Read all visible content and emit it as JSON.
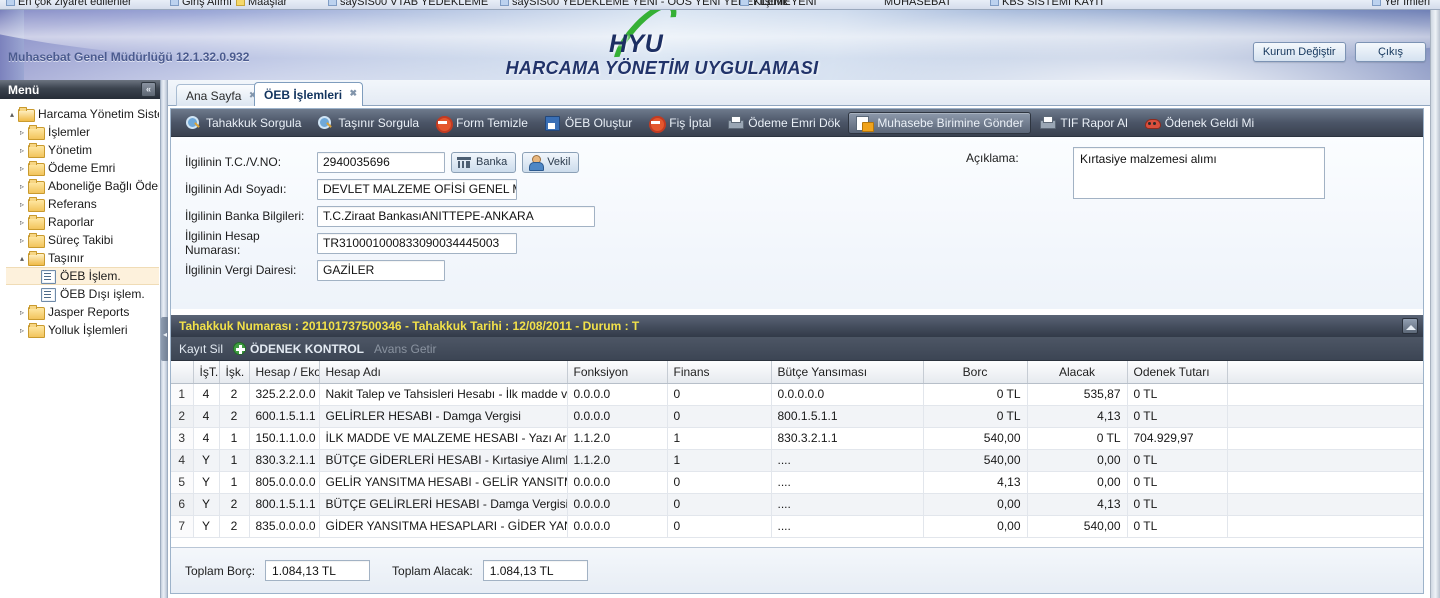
{
  "browser": {
    "bookmarks": [
      {
        "label": "En çok ziyaret edilenler",
        "icon": "bookmark-icon"
      },
      {
        "label": "Giriş Alımı",
        "icon": "bookmark-icon"
      },
      {
        "label": "Maaşlar",
        "icon": "folder-icon"
      },
      {
        "label": "saySIS00 VTAB YEDEKLEME",
        "icon": "bookmark-icon"
      },
      {
        "label": "saySIS00 YEDEKLEME YENI - OOS YENI YEDEKLEME",
        "icon": "bookmark-icon"
      },
      {
        "label": "Yılşırlık YENI",
        "icon": "bookmark-icon"
      },
      {
        "label": "MUHASEBAT",
        "icon": "star-icon"
      },
      {
        "label": "KBS SİSTEMİ KAYIT",
        "icon": "bookmark-icon"
      },
      {
        "label": "Yer İmleri",
        "icon": "bookmark-icon"
      }
    ]
  },
  "banner": {
    "version": "Muhasebat Genel Müdürlüğü 12.1.32.0.932",
    "logo_text": "HYU",
    "subtitle": "HARCAMA YÖNETİM UYGULAMASI",
    "buttons": [
      {
        "label": "Kurum Değiştir",
        "name": "kurum-degistir-button"
      },
      {
        "label": "Çıkış",
        "name": "cikis-button"
      }
    ]
  },
  "menu": {
    "title": "Menü",
    "collapse_icon": "double-chevron-left-icon",
    "tree": [
      {
        "label": "Harcama Yönetim Sistemi",
        "level": 0,
        "type": "folder-open",
        "arrow": "▴",
        "selected": false
      },
      {
        "label": "İşlemler",
        "level": 1,
        "type": "folder",
        "arrow": "▹",
        "selected": false
      },
      {
        "label": "Yönetim",
        "level": 1,
        "type": "folder",
        "arrow": "▹",
        "selected": false
      },
      {
        "label": "Ödeme Emri",
        "level": 1,
        "type": "folder",
        "arrow": "▹",
        "selected": false
      },
      {
        "label": "Aboneliğe Bağlı Ödeme",
        "level": 1,
        "type": "folder",
        "arrow": "▹",
        "selected": false
      },
      {
        "label": "Referans",
        "level": 1,
        "type": "folder",
        "arrow": "▹",
        "selected": false
      },
      {
        "label": "Raporlar",
        "level": 1,
        "type": "folder",
        "arrow": "▹",
        "selected": false
      },
      {
        "label": "Süreç Takibi",
        "level": 1,
        "type": "folder",
        "arrow": "▹",
        "selected": false
      },
      {
        "label": "Taşınır",
        "level": 1,
        "type": "folder-open",
        "arrow": "▴",
        "selected": false
      },
      {
        "label": "ÖEB İşlem.",
        "level": 2,
        "type": "leaf",
        "arrow": "",
        "selected": true
      },
      {
        "label": "ÖEB Dışı işlem.",
        "level": 2,
        "type": "leaf",
        "arrow": "",
        "selected": false
      },
      {
        "label": "Jasper Reports",
        "level": 1,
        "type": "folder",
        "arrow": "▹",
        "selected": false
      },
      {
        "label": "Yolluk İşlemleri",
        "level": 1,
        "type": "folder",
        "arrow": "▹",
        "selected": false
      }
    ]
  },
  "tabs": [
    {
      "label": "Ana Sayfa",
      "active": false,
      "close_icon": "close-icon"
    },
    {
      "label": "ÖEB İşlemleri",
      "active": true,
      "close_icon": "close-icon"
    }
  ],
  "toolbar": [
    {
      "label": "Tahakkuk Sorgula",
      "icon": "search-icon",
      "active": false
    },
    {
      "label": "Taşınır Sorgula",
      "icon": "search-icon",
      "active": false
    },
    {
      "label": "Form Temizle",
      "icon": "cancel-icon",
      "active": false
    },
    {
      "label": "ÖEB Oluştur",
      "icon": "save-icon",
      "active": false
    },
    {
      "label": "Fiş İptal",
      "icon": "cancel-icon",
      "active": false
    },
    {
      "label": "Ödeme Emri Dök",
      "icon": "print-icon",
      "active": false
    },
    {
      "label": "Muhasebe Birimine Gönder",
      "icon": "send-icon",
      "active": true
    },
    {
      "label": "TIF Rapor Al",
      "icon": "print-icon",
      "active": false
    },
    {
      "label": "Ödenek Geldi Mi",
      "icon": "mask-icon",
      "active": false
    }
  ],
  "form": {
    "fields": [
      {
        "label": "İlgilinin T.C./V.NO:",
        "value": "2940035696",
        "name": "tc-vno-field"
      },
      {
        "label": "İlgilinin Adı Soyadı:",
        "value": "DEVLET MALZEME OFİSİ GENEL Mİ",
        "name": "adi-soyadi-field"
      },
      {
        "label": "İlgilinin Banka Bilgileri:",
        "value": "T.C.Ziraat BankasıANITTEPE-ANKARA",
        "name": "banka-bilgileri-field"
      },
      {
        "label": "İlgilinin Hesap Numarası:",
        "value": "TR310001000833090034445003",
        "name": "hesap-numarasi-field"
      },
      {
        "label": "İlgilinin Vergi Dairesi:",
        "value": "GAZİLER",
        "name": "vergi-dairesi-field"
      }
    ],
    "banka_button": "Banka",
    "vekil_button": "Vekil",
    "aciklama_label": "Açıklama:",
    "aciklama_value": "Kırtasiye malzemesi alımı"
  },
  "infobar": {
    "text": "Tahakkuk Numarası : 201101737500346 - Tahakkuk Tarihi : 12/08/2011 - Durum : T",
    "collapse_icon": "collapse-up-icon"
  },
  "actions": [
    {
      "label": "Kayıt Sil",
      "style": "normal",
      "name": "kayit-sil-button"
    },
    {
      "label": "ÖDENEK KONTROL",
      "style": "strong",
      "name": "odenek-kontrol-button"
    },
    {
      "label": "Avans Getir",
      "style": "dim",
      "name": "avans-getir-button"
    }
  ],
  "grid": {
    "columns": [
      "",
      "İşT.",
      "İşk.",
      "Hesap / Ekod",
      "Hesap Adı",
      "Fonksiyon",
      "Finans",
      "Bütçe Yansıması",
      "Borc",
      "Alacak",
      "Odenek Tutarı",
      ""
    ],
    "rows": [
      [
        "1",
        "4",
        "2",
        "325.2.2.0.0",
        "Nakit Talep ve Tahsisleri Hesabı - İlk madde ve malz",
        "0.0.0.0",
        "0",
        "0.0.0.0.0",
        "0 TL",
        "535,87",
        "0 TL",
        ""
      ],
      [
        "2",
        "4",
        "2",
        "600.1.5.1.1",
        "GELİRLER HESABI - Damga Vergisi",
        "0.0.0.0",
        "0",
        "800.1.5.1.1",
        "0 TL",
        "4,13",
        "0 TL",
        ""
      ],
      [
        "3",
        "4",
        "1",
        "150.1.1.0.0",
        "İLK MADDE VE MALZEME HESABI - Yazı Araçları",
        "1.1.2.0",
        "1",
        "830.3.2.1.1",
        "540,00",
        "0 TL",
        "704.929,97",
        ""
      ],
      [
        "4",
        "Y",
        "1",
        "830.3.2.1.1",
        "BÜTÇE GİDERLERİ HESABI - Kırtasiye Alımları",
        "1.1.2.0",
        "1",
        "....",
        "540,00",
        "0,00",
        "0 TL",
        ""
      ],
      [
        "5",
        "Y",
        "1",
        "805.0.0.0.0",
        "GELİR YANSITMA HESABI - GELİR YANSITMA HES",
        "0.0.0.0",
        "0",
        "....",
        "4,13",
        "0,00",
        "0 TL",
        ""
      ],
      [
        "6",
        "Y",
        "2",
        "800.1.5.1.1",
        "BÜTÇE GELİRLERİ HESABI - Damga Vergisi",
        "0.0.0.0",
        "0",
        "....",
        "0,00",
        "4,13",
        "0 TL",
        ""
      ],
      [
        "7",
        "Y",
        "2",
        "835.0.0.0.0",
        "GİDER YANSITMA HESAPLARI - GİDER YANSITMA",
        "0.0.0.0",
        "0",
        "....",
        "0,00",
        "540,00",
        "0 TL",
        ""
      ]
    ]
  },
  "totals": {
    "borc_label": "Toplam Borç:",
    "borc_value": "1.084,13 TL",
    "alacak_label": "Toplam Alacak:",
    "alacak_value": "1.084,13 TL"
  }
}
